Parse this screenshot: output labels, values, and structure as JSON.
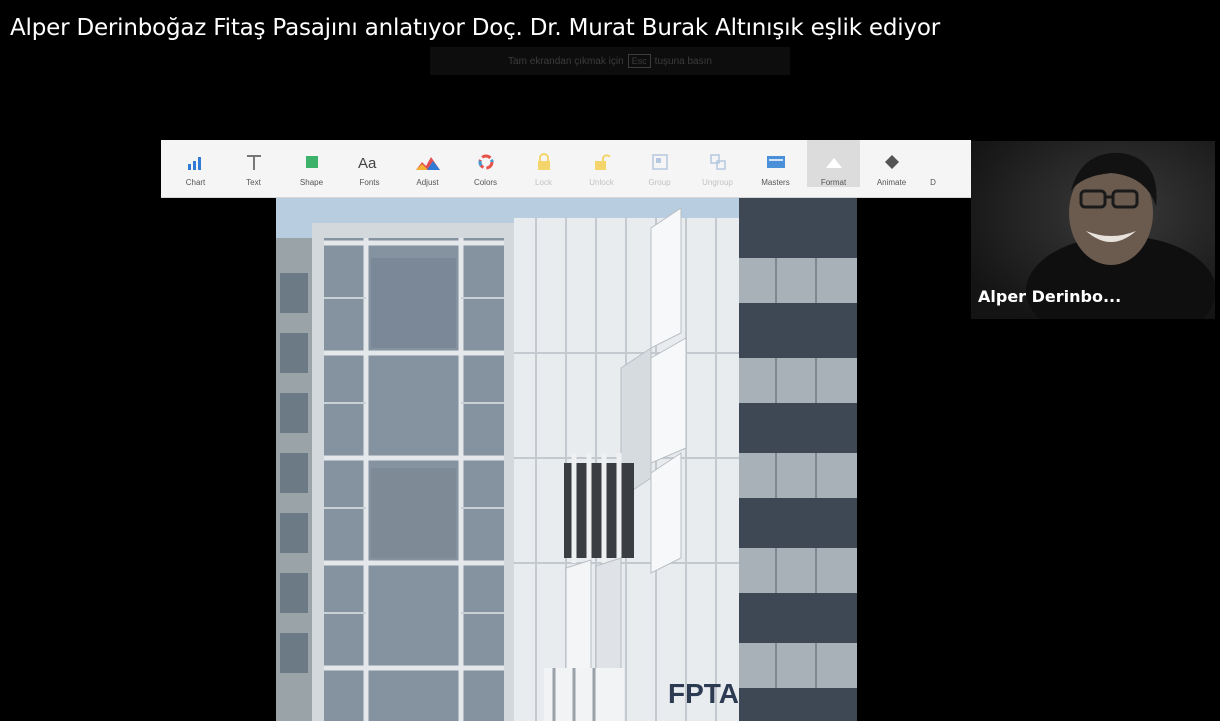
{
  "meeting": {
    "title": "Alper Derinboğaz Fitaş Pasajını anlatıyor Doç. Dr. Murat Burak Altınışık eşlik ediyor",
    "fullscreen_hint": {
      "before": "Tam ekrandan çıkmak için",
      "key": "Esc",
      "after": "tuşuna basın"
    }
  },
  "toolbar": {
    "items": [
      {
        "label": "Chart",
        "icon": "chart-icon",
        "enabled": true
      },
      {
        "label": "Text",
        "icon": "text-icon",
        "enabled": true
      },
      {
        "label": "Shape",
        "icon": "shape-icon",
        "enabled": true
      },
      {
        "label": "Fonts",
        "icon": "fonts-icon",
        "enabled": true
      },
      {
        "label": "Adjust",
        "icon": "adjust-icon",
        "enabled": true
      },
      {
        "label": "Colors",
        "icon": "colors-icon",
        "enabled": true
      },
      {
        "label": "Lock",
        "icon": "lock-icon",
        "enabled": false
      },
      {
        "label": "Unlock",
        "icon": "unlock-icon",
        "enabled": false
      },
      {
        "label": "Group",
        "icon": "group-icon",
        "enabled": false
      },
      {
        "label": "Ungroup",
        "icon": "ungroup-icon",
        "enabled": false
      },
      {
        "label": "Masters",
        "icon": "masters-icon",
        "enabled": true
      },
      {
        "label": "Format",
        "icon": "format-icon",
        "enabled": true
      },
      {
        "label": "Animate",
        "icon": "animate-icon",
        "enabled": true
      },
      {
        "label": "D",
        "icon": "document-icon",
        "enabled": true
      }
    ]
  },
  "slide": {
    "sign_text": "FPTA"
  },
  "participant": {
    "name": "Alper Derinbo..."
  }
}
